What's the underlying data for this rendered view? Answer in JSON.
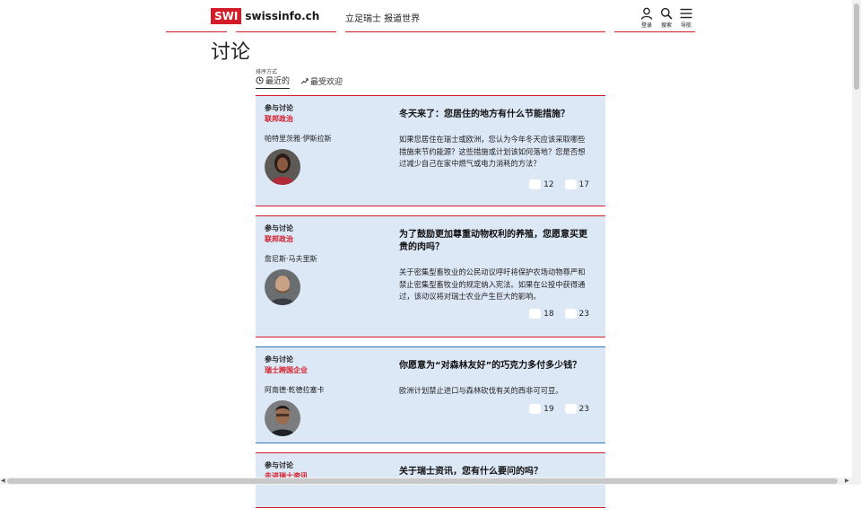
{
  "header": {
    "logo_badge": "SWI",
    "logo_text": "swissinfo.ch",
    "tagline": "立足瑞士 报道世界",
    "nav": [
      {
        "label": "登录",
        "icon": "user-icon"
      },
      {
        "label": "搜索",
        "icon": "search-icon"
      },
      {
        "label": "导航",
        "icon": "menu-icon"
      }
    ]
  },
  "page": {
    "title": "讨论",
    "sort_label": "排序方式",
    "sort_options": [
      {
        "label": "最近的",
        "icon": "clock-icon",
        "active": true
      },
      {
        "label": "最受欢迎",
        "icon": "trending-icon",
        "active": false
      }
    ]
  },
  "cards": [
    {
      "kicker": "参与讨论",
      "category": "联邦政治",
      "author": "帕特里茨雅·伊斯拉斯",
      "title": "冬天来了：您居住的地方有什么节能措施？",
      "description": "如果您居住在瑞士或欧洲，您认为今年冬天应该采取哪些措施来节约能源？这些措施或计划该如何落地？您是否想过减少自己在家中燃气或电力消耗的方法？",
      "stat1": "12",
      "stat2": "17",
      "accent": "#d21d29"
    },
    {
      "kicker": "参与讨论",
      "category": "联邦政治",
      "author": "詹尼斯·马夫里斯",
      "title": "为了鼓励更加尊重动物权利的养殖，您愿意买更贵的肉吗？",
      "description": "关于密集型畜牧业的公民动议呼吁将保护农场动物尊严和禁止密集型畜牧业的规定纳入宪法。如果在公投中获得通过，该动议将对瑞士农业产生巨大的影响。",
      "stat1": "18",
      "stat2": "23",
      "accent": "#d21d29"
    },
    {
      "kicker": "参与讨论",
      "category": "瑞士跨国企业",
      "author": "阿南德·乾德拉塞卡",
      "title": "你愿意为“对森林友好”的巧克力多付多少钱？",
      "description": "欧洲计划禁止进口与森林砍伐有关的西非可可豆。",
      "stat1": "19",
      "stat2": "23",
      "accent": "#2a78c0"
    },
    {
      "kicker": "参与讨论",
      "category": "走进瑞士资讯",
      "author": "",
      "title": "关于瑞士资讯，您有什么要问的吗？",
      "description": "",
      "stat1": "",
      "stat2": "",
      "accent": "#d21d29"
    }
  ]
}
